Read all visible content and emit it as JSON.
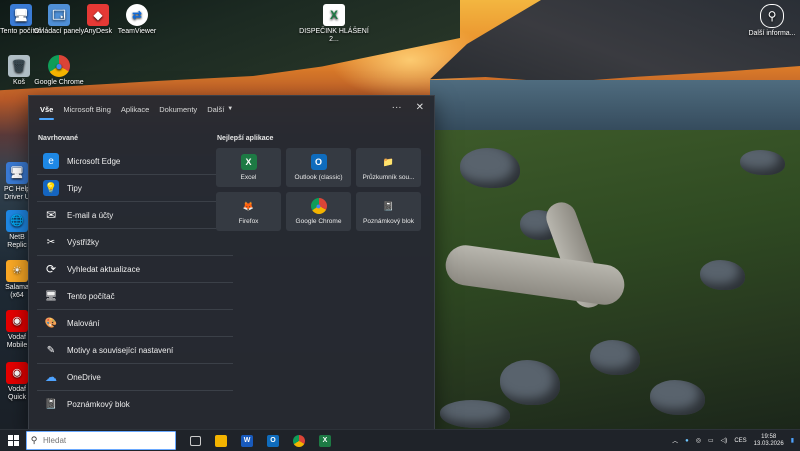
{
  "desktop": {
    "icons": [
      {
        "label": "Tento počítač",
        "glyph": "🖥"
      },
      {
        "label": "Ovládací panely",
        "glyph": "🗔"
      },
      {
        "label": "AnyDesk",
        "glyph": "◆"
      },
      {
        "label": "TeamViewer",
        "glyph": "⇄"
      },
      {
        "label": "DISPEČINK HLÁŠENÍ 2...",
        "glyph": "X"
      },
      {
        "label": "Další informa...",
        "glyph": "⚲"
      },
      {
        "label": "Koš",
        "glyph": "🗑"
      },
      {
        "label": "Google Chrome",
        "glyph": "●"
      }
    ],
    "partial_icons": [
      {
        "label": "PC Help Driver U",
        "glyph": "🖥"
      },
      {
        "label": "NetB Replic",
        "glyph": "🌐"
      },
      {
        "label": "Salama (x64",
        "glyph": "☀"
      },
      {
        "label": "Vodaf Mobile",
        "glyph": "◉"
      },
      {
        "label": "Vodaf Quick",
        "glyph": "◉"
      }
    ]
  },
  "search_panel": {
    "tabs": [
      "Vše",
      "Microsoft Bing",
      "Aplikace",
      "Dokumenty",
      "Další"
    ],
    "more_icon": "···",
    "close_icon": "✕",
    "suggested_title": "Navrhované",
    "suggestions": [
      {
        "label": "Microsoft Edge",
        "glyph": "e",
        "color": "#1e88e5"
      },
      {
        "label": "Tipy",
        "glyph": "💡",
        "color": "#1565c0"
      },
      {
        "label": "E-mail a účty",
        "glyph": "✉",
        "color": "#444"
      },
      {
        "label": "Výstřižky",
        "glyph": "✂",
        "color": "#555"
      },
      {
        "label": "Vyhledat aktualizace",
        "glyph": "⟳",
        "color": "#444"
      },
      {
        "label": "Tento počítač",
        "glyph": "🖥",
        "color": "#1976d2"
      },
      {
        "label": "Malování",
        "glyph": "🎨",
        "color": "#666"
      },
      {
        "label": "Motivy a související nastavení",
        "glyph": "✎",
        "color": "#444"
      },
      {
        "label": "OneDrive",
        "glyph": "☁",
        "color": "#1e88e5"
      },
      {
        "label": "Poznámkový blok",
        "glyph": "📓",
        "color": "#5c9bd5"
      }
    ],
    "top_apps_title": "Nejlepší aplikace",
    "top_apps": [
      {
        "label": "Excel",
        "glyph": "X",
        "color": "#1d7a44"
      },
      {
        "label": "Outlook (classic)",
        "glyph": "O",
        "color": "#0f6cbd"
      },
      {
        "label": "Průzkumník sou...",
        "glyph": "📁",
        "color": "#f4b400"
      },
      {
        "label": "Firefox",
        "glyph": "🦊",
        "color": "#e66000"
      },
      {
        "label": "Google Chrome",
        "glyph": "●",
        "color": "#db4437"
      },
      {
        "label": "Poznámkový blok",
        "glyph": "📓",
        "color": "#5c9bd5"
      }
    ]
  },
  "taskbar": {
    "search_placeholder": "Hledat",
    "search_value": "",
    "language": "CES",
    "time": "19:58",
    "date": "13.03.2026"
  }
}
